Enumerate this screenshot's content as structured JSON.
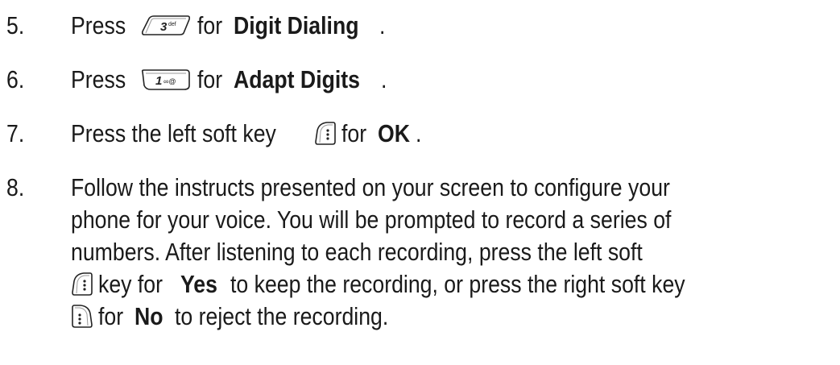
{
  "steps": [
    {
      "number": "5.",
      "prefix": "Press",
      "key_icon": "key-3def-icon",
      "middle": "for",
      "bold": "Digit Dialing",
      "suffix": "."
    },
    {
      "number": "6.",
      "prefix": "Press",
      "key_icon": "key-1-voicemail-icon",
      "middle": "for",
      "bold": "Adapt Digits",
      "suffix": "."
    },
    {
      "number": "7.",
      "prefix": "Press the left soft key",
      "key_icon": "left-soft-key-icon",
      "middle": "for",
      "bold": "OK",
      "suffix": "."
    },
    {
      "number": "8.",
      "line1": "Follow the instructs presented on your screen to configure your",
      "line2": "phone for your voice. You will be prompted to record a series of",
      "line3": "numbers. After listening to each recording, press the left soft",
      "line4_a": "key for",
      "line4_bold": "Yes",
      "line4_b": "to keep the recording, or press the right soft key",
      "line5_a": "for",
      "line5_bold": "No",
      "line5_b": "to reject the recording."
    }
  ]
}
